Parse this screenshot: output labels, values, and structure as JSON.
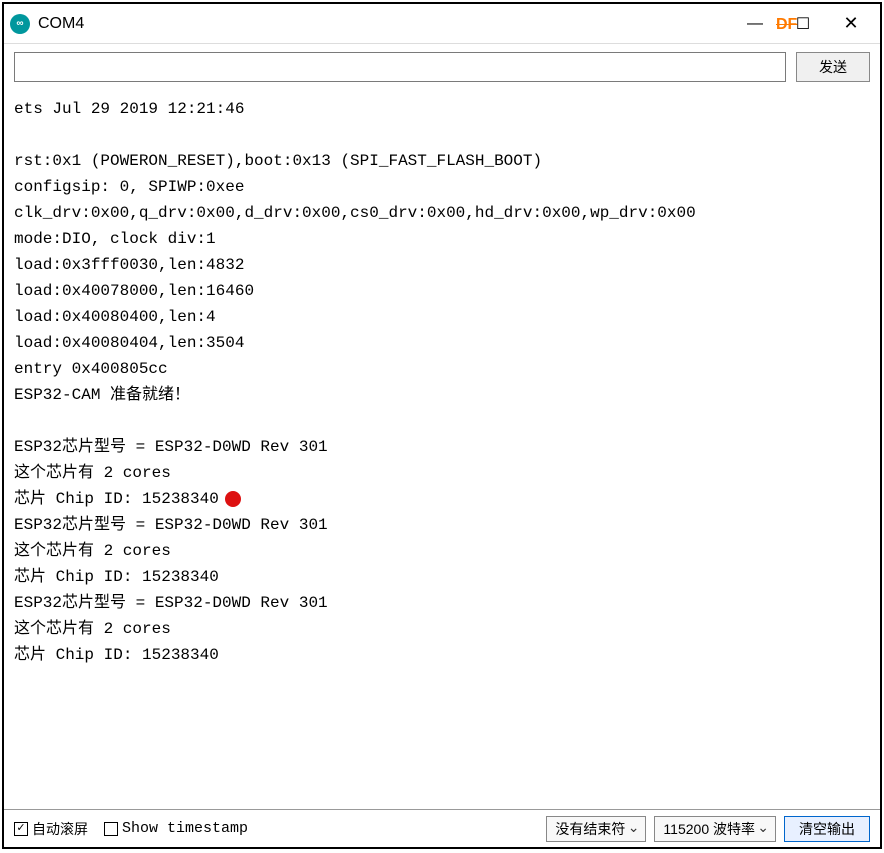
{
  "titlebar": {
    "title": "COM4",
    "df_badge": "DF"
  },
  "send": {
    "input_value": "",
    "send_label": "发送"
  },
  "console_lines": [
    "ets Jul 29 2019 12:21:46",
    "",
    "rst:0x1 (POWERON_RESET),boot:0x13 (SPI_FAST_FLASH_BOOT)",
    "configsip: 0, SPIWP:0xee",
    "clk_drv:0x00,q_drv:0x00,d_drv:0x00,cs0_drv:0x00,hd_drv:0x00,wp_drv:0x00",
    "mode:DIO, clock div:1",
    "load:0x3fff0030,len:4832",
    "load:0x40078000,len:16460",
    "load:0x40080400,len:4",
    "load:0x40080404,len:3504",
    "entry 0x400805cc",
    "ESP32-CAM 准备就绪！",
    "",
    "ESP32芯片型号 = ESP32-D0WD Rev 301",
    "这个芯片有 2 cores",
    "芯片 Chip ID: 15238340",
    "ESP32芯片型号 = ESP32-D0WD Rev 301",
    "这个芯片有 2 cores",
    "芯片 Chip ID: 15238340",
    "ESP32芯片型号 = ESP32-D0WD Rev 301",
    "这个芯片有 2 cores",
    "芯片 Chip ID: 15238340"
  ],
  "console_dot_line_index": 15,
  "status": {
    "autoscroll_label": "自动滚屏",
    "autoscroll_checked": true,
    "show_timestamp_label": "Show timestamp",
    "show_timestamp_checked": false,
    "line_ending_selected": "没有结束符",
    "baud_selected": "115200 波特率",
    "clear_label": "清空输出"
  }
}
